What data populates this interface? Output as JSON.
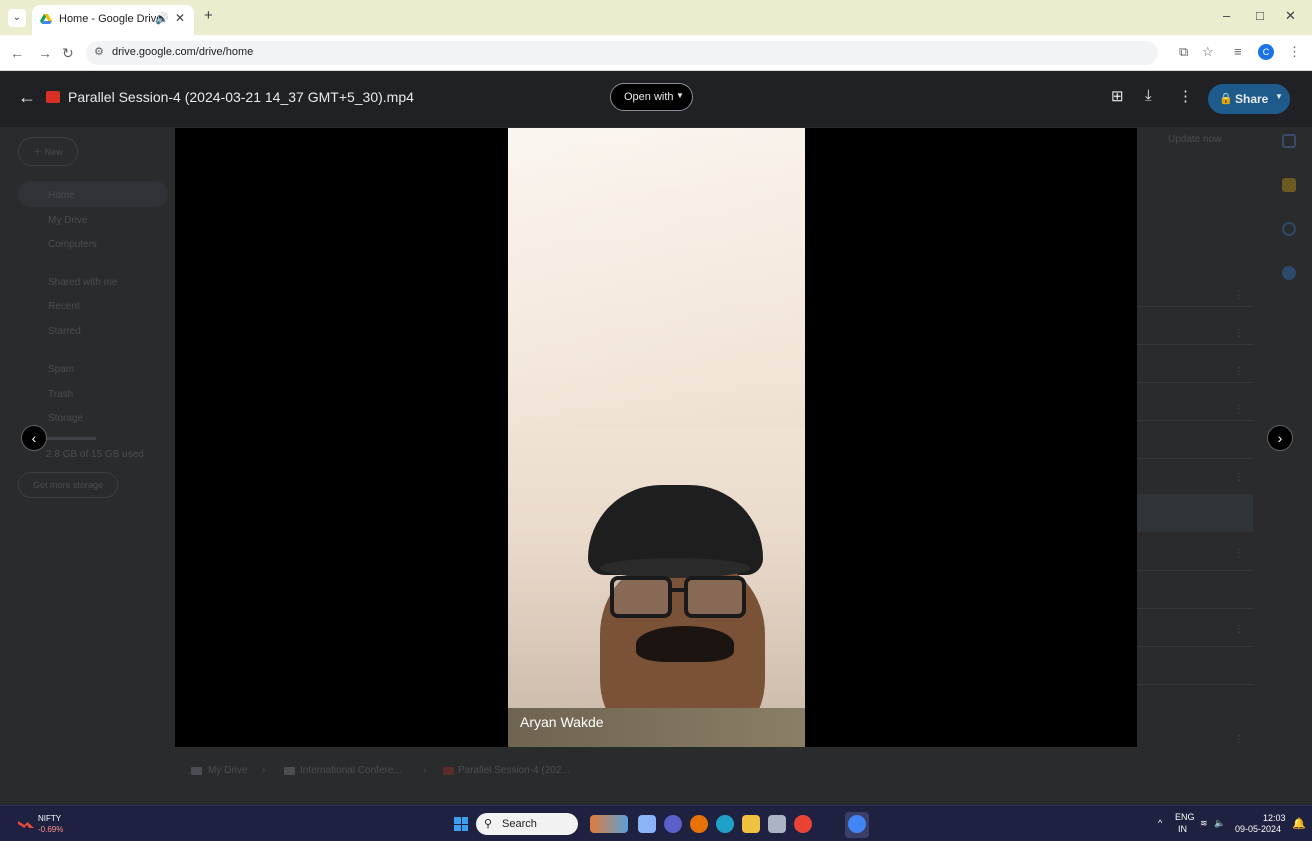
{
  "browser": {
    "tab_switcher_icon": "chevron-down-icon",
    "tab": {
      "title": "Home - Google Drive",
      "audio_icon": "🔊",
      "close": "✕"
    },
    "new_tab": "+",
    "window_controls": {
      "minimize": "–",
      "restore": "□",
      "close": "✕"
    },
    "nav": {
      "back": "←",
      "forward": "→",
      "reload": "↻"
    },
    "url": "drive.google.com/drive/home",
    "profile_initial": "C"
  },
  "drive_background": {
    "new_button": "New",
    "sidebar": [
      "Home",
      "My Drive",
      "Computers",
      "Shared with me",
      "Recent",
      "Starred",
      "Spam",
      "Trash",
      "Storage"
    ],
    "storage_text": "2.8 GB of 15 GB used",
    "get_storage": "Get more storage",
    "update_text": "Update now"
  },
  "viewer": {
    "file_name": "Parallel Session-4 (2024-03-21 14_37 GMT+5_30).mp4",
    "open_with": "Open with",
    "share_label": "Share",
    "participant_name": "Aryan Wakde",
    "prev": "‹",
    "next": "›"
  },
  "breadcrumb": [
    "My Drive",
    "International Confere...",
    "Parallel Session-4 (202..."
  ],
  "taskbar": {
    "ticker_name": "NIFTY",
    "ticker_change": "-0.69%",
    "search_label": "Search",
    "language": "ENG",
    "region": "IN",
    "time": "12:03",
    "date": "09-05-2024"
  },
  "colors": {
    "accent": "#1a73e8",
    "share_bg": "#1e5b8c",
    "file_icon": "#d93025",
    "taskbar": "#1e2140"
  }
}
